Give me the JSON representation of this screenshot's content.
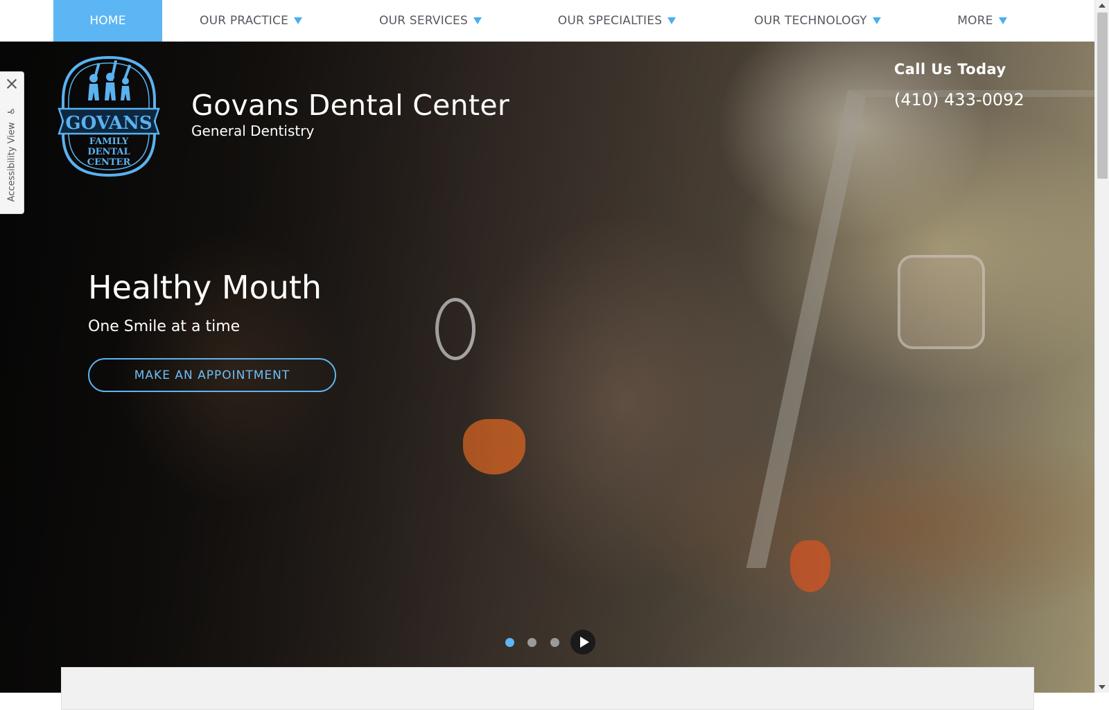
{
  "nav": {
    "items": [
      {
        "label": "HOME",
        "active": true,
        "has_dropdown": false
      },
      {
        "label": "OUR PRACTICE",
        "active": false,
        "has_dropdown": true
      },
      {
        "label": "OUR SERVICES",
        "active": false,
        "has_dropdown": true
      },
      {
        "label": "OUR SPECIALTIES",
        "active": false,
        "has_dropdown": true
      },
      {
        "label": "OUR TECHNOLOGY",
        "active": false,
        "has_dropdown": true
      },
      {
        "label": "MORE",
        "active": false,
        "has_dropdown": true
      }
    ],
    "dropdown_icon": "triangle-down-icon"
  },
  "header": {
    "logo": {
      "text": "GOVANS FAMILY DENTAL CENTER",
      "icon": "family-with-toothbrushes-logo"
    },
    "title": "Govans Dental Center",
    "subtitle": "General Dentistry",
    "call_label": "Call Us Today",
    "phone": "(410) 433-0092"
  },
  "hero": {
    "heading": "Healthy Mouth",
    "subheading": "One Smile at a time",
    "cta_label": "MAKE AN APPOINTMENT",
    "image": "two-women-blowing-bubbles-in-van-photo"
  },
  "slider": {
    "slide_count": 3,
    "active_index": 0,
    "play_icon": "play-icon"
  },
  "accessibility": {
    "label": "Accessibility View",
    "close_icon": "close-icon",
    "icon": "wheelchair-icon"
  },
  "colors": {
    "accent": "#5bb6f3",
    "nav_text": "#55595f",
    "logo_blue": "#5ab2ef"
  }
}
